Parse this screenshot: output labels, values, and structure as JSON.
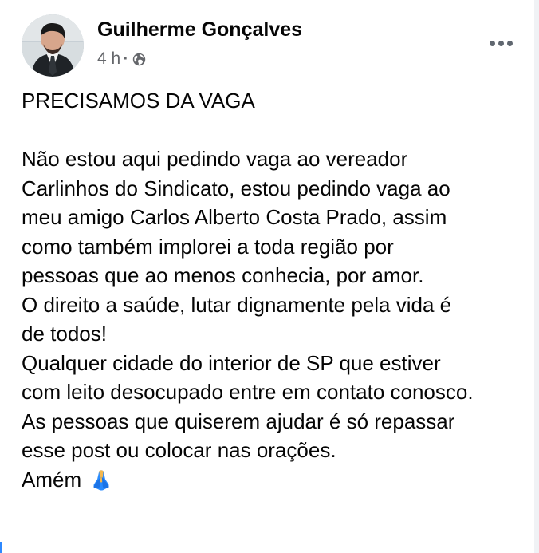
{
  "post": {
    "author": "Guilherme Gonçalves",
    "time": "4 h",
    "separator": "·",
    "privacy_icon": "globe-icon",
    "more_icon": "more-options-icon",
    "lines": [
      "PRECISAMOS DA VAGA",
      "",
      "Não estou aqui pedindo vaga ao vereador",
      "Carlinhos do Sindicato, estou pedindo vaga ao",
      "meu amigo Carlos Alberto Costa Prado, assim",
      "como também implorei a toda região por",
      "pessoas que ao menos conhecia, por amor.",
      "O direito a saúde, lutar dignamente pela vida é",
      "de todos!",
      "Qualquer cidade do interior de SP que estiver",
      "com leito desocupado entre em contato conosco.",
      "As pessoas que quiserem ajudar é só repassar",
      "esse post ou colocar nas orações.",
      "Amém"
    ],
    "final_emoji_icon": "folded-hands-icon"
  },
  "colors": {
    "text": "#050505",
    "secondary_text": "#65676b",
    "icon_gray": "#606770",
    "emoji_blue": "#2a8cff",
    "emoji_skin": "#f5b84d"
  }
}
